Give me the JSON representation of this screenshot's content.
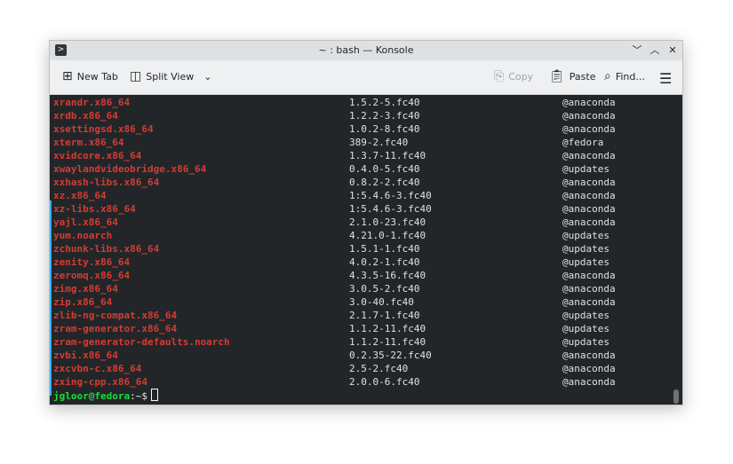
{
  "window": {
    "title": "~ : bash — Konsole"
  },
  "toolbar": {
    "new_tab": "New Tab",
    "split_view": "Split View",
    "copy": "Copy",
    "paste": "Paste",
    "find": "Find..."
  },
  "rows": [
    {
      "pkg": "xrandr.x86_64",
      "ver": "1.5.2-5.fc40",
      "repo": "@anaconda"
    },
    {
      "pkg": "xrdb.x86_64",
      "ver": "1.2.2-3.fc40",
      "repo": "@anaconda"
    },
    {
      "pkg": "xsettingsd.x86_64",
      "ver": "1.0.2-8.fc40",
      "repo": "@anaconda"
    },
    {
      "pkg": "xterm.x86_64",
      "ver": "389-2.fc40",
      "repo": "@fedora"
    },
    {
      "pkg": "xvidcore.x86_64",
      "ver": "1.3.7-11.fc40",
      "repo": "@anaconda"
    },
    {
      "pkg": "xwaylandvideobridge.x86_64",
      "ver": "0.4.0-5.fc40",
      "repo": "@updates"
    },
    {
      "pkg": "xxhash-libs.x86_64",
      "ver": "0.8.2-2.fc40",
      "repo": "@anaconda"
    },
    {
      "pkg": "xz.x86_64",
      "ver": "1:5.4.6-3.fc40",
      "repo": "@anaconda"
    },
    {
      "pkg": "xz-libs.x86_64",
      "ver": "1:5.4.6-3.fc40",
      "repo": "@anaconda"
    },
    {
      "pkg": "yajl.x86_64",
      "ver": "2.1.0-23.fc40",
      "repo": "@anaconda"
    },
    {
      "pkg": "yum.noarch",
      "ver": "4.21.0-1.fc40",
      "repo": "@updates"
    },
    {
      "pkg": "zchunk-libs.x86_64",
      "ver": "1.5.1-1.fc40",
      "repo": "@updates"
    },
    {
      "pkg": "zenity.x86_64",
      "ver": "4.0.2-1.fc40",
      "repo": "@updates"
    },
    {
      "pkg": "zeromq.x86_64",
      "ver": "4.3.5-16.fc40",
      "repo": "@anaconda"
    },
    {
      "pkg": "zimg.x86_64",
      "ver": "3.0.5-2.fc40",
      "repo": "@anaconda"
    },
    {
      "pkg": "zip.x86_64",
      "ver": "3.0-40.fc40",
      "repo": "@anaconda"
    },
    {
      "pkg": "zlib-ng-compat.x86_64",
      "ver": "2.1.7-1.fc40",
      "repo": "@updates"
    },
    {
      "pkg": "zram-generator.x86_64",
      "ver": "1.1.2-11.fc40",
      "repo": "@updates"
    },
    {
      "pkg": "zram-generator-defaults.noarch",
      "ver": "1.1.2-11.fc40",
      "repo": "@updates"
    },
    {
      "pkg": "zvbi.x86_64",
      "ver": "0.2.35-22.fc40",
      "repo": "@anaconda"
    },
    {
      "pkg": "zxcvbn-c.x86_64",
      "ver": "2.5-2.fc40",
      "repo": "@anaconda"
    },
    {
      "pkg": "zxing-cpp.x86_64",
      "ver": "2.0.0-6.fc40",
      "repo": "@anaconda"
    }
  ],
  "prompt": {
    "user_host": "jgloor@fedora",
    "path": ":~$"
  }
}
